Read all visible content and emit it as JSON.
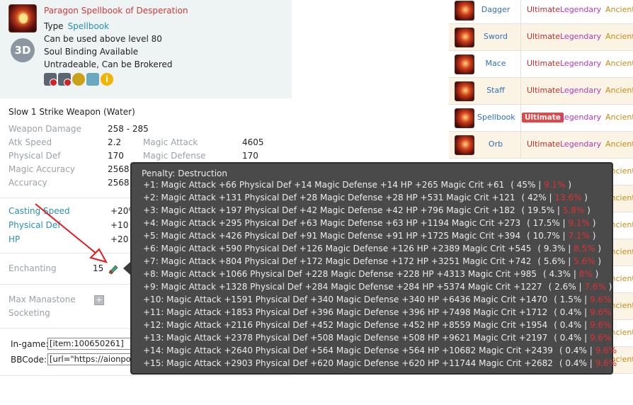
{
  "item": {
    "name": "Paragon Spellbook of Desperation",
    "type_label": "Type",
    "type_value": "Spellbook",
    "level_text": "Can be used above level 80",
    "soul_binding": "Soul Binding Available",
    "trade_text": "Untradeable, Can be Brokered",
    "badge_3d": "3D",
    "info_glyph": "i"
  },
  "subtitle": "Slow 1 Strike Weapon (Water)",
  "stats": [
    {
      "label": "Weapon Damage",
      "value": "258 - 285"
    },
    {
      "label": "Atk Speed",
      "value": "2.2",
      "label2": "Magic Attack",
      "value2": "4605"
    },
    {
      "label": "Physical Def",
      "value": "170",
      "label2": "Magic Defense",
      "value2": "170"
    },
    {
      "label": "Magic Accuracy",
      "value": "2568"
    },
    {
      "label": "Accuracy",
      "value": "2568"
    }
  ],
  "bonuses": [
    {
      "label": "Casting Speed",
      "value": "+20%"
    },
    {
      "label": "Physical Def",
      "value": "+10"
    },
    {
      "label": "HP",
      "value": "+20"
    }
  ],
  "enchanting": {
    "label": "Enchanting",
    "value": "15"
  },
  "manastone": {
    "label1": "Max Manastone",
    "label2": "Socketing",
    "glyph": "+"
  },
  "codes": {
    "ingame_label": "In-game:",
    "ingame_value": "[item:100650261]",
    "bbcode_label": "BBCode:",
    "bbcode_value": "[url=\"https://aionpow"
  },
  "weapons": [
    {
      "name": "Dagger",
      "ultimate": "Ultimate",
      "legendary": "Legendary",
      "ancient": "Ancient"
    },
    {
      "name": "Sword",
      "ultimate": "Ultimate",
      "legendary": "Legendary",
      "ancient": "Ancient"
    },
    {
      "name": "Mace",
      "ultimate": "Ultimate",
      "legendary": "Legendary",
      "ancient": "Ancient"
    },
    {
      "name": "Staff",
      "ultimate": "Ultimate",
      "legendary": "Legendary",
      "ancient": "Ancient"
    },
    {
      "name": "Spellbook",
      "ultimate": "Ultimate",
      "legendary": "Legendary",
      "ancient": "Ancient",
      "selected": true
    },
    {
      "name": "Orb",
      "ultimate": "Ultimate",
      "legendary": "Legendary",
      "ancient": "Ancient"
    }
  ],
  "hidden_ancient_labels": [
    "Ancient",
    "Ancient",
    "Ancient",
    "Ancient",
    "Ancient",
    "Ancient",
    "Ancient",
    "Ancient"
  ],
  "tooltip": {
    "title": "Penalty: Destruction",
    "lines": [
      {
        "text": "+1: Magic Attack +66 Physical Def +14 Magic Defense +14 HP +265 Magic Crit +61",
        "chance": "( 45% |",
        "penalty": "9.1%",
        "close": ")"
      },
      {
        "text": "+2: Magic Attack +131 Physical Def +28 Magic Defense +28 HP +531 Magic Crit +121",
        "chance": "( 42% |",
        "penalty": "13.6%",
        "close": ")"
      },
      {
        "text": "+3: Magic Attack +197 Physical Def +42 Magic Defense +42 HP +796 Magic Crit +182",
        "chance": "( 19.5% |",
        "penalty": "5.8%",
        "close": ")"
      },
      {
        "text": "+4: Magic Attack +295 Physical Def +63 Magic Defense +63 HP +1194 Magic Crit +273",
        "chance": "( 17.5% |",
        "penalty": "9.1%",
        "close": ")"
      },
      {
        "text": "+5: Magic Attack +426 Physical Def +91 Magic Defense +91 HP +1725 Magic Crit +394",
        "chance": "( 10.7% |",
        "penalty": "7.1%",
        "close": ")"
      },
      {
        "text": "+6: Magic Attack +590 Physical Def +126 Magic Defense +126 HP +2389 Magic Crit +545",
        "chance": "( 9.3% |",
        "penalty": "8.5%",
        "close": ")"
      },
      {
        "text": "+7: Magic Attack +804 Physical Def +172 Magic Defense +172 HP +3251 Magic Crit +742",
        "chance": "( 5.6% |",
        "penalty": "5.6%",
        "close": ")"
      },
      {
        "text": "+8: Magic Attack +1066 Physical Def +228 Magic Defense +228 HP +4313 Magic Crit +985",
        "chance": "( 4.3% |",
        "penalty": "8%",
        "close": ")"
      },
      {
        "text": "+9: Magic Attack +1328 Physical Def +284 Magic Defense +284 HP +5374 Magic Crit +1227",
        "chance": "( 2.6% |",
        "penalty": "7.6%",
        "close": ")"
      },
      {
        "text": "+10: Magic Attack +1591 Physical Def +340 Magic Defense +340 HP +6436 Magic Crit +1470",
        "chance": "( 1.5% |",
        "penalty": "9.6%",
        "close": ")"
      },
      {
        "text": "+11: Magic Attack +1853 Physical Def +396 Magic Defense +396 HP +7498 Magic Crit +1712",
        "chance": "( 0.4% |",
        "penalty": "9.6%",
        "close": ")"
      },
      {
        "text": "+12: Magic Attack +2116 Physical Def +452 Magic Defense +452 HP +8559 Magic Crit +1954",
        "chance": "( 0.4% |",
        "penalty": "9.6%",
        "close": ")"
      },
      {
        "text": "+13: Magic Attack +2378 Physical Def +508 Magic Defense +508 HP +9621 Magic Crit +2197",
        "chance": "( 0.4% |",
        "penalty": "9.6%",
        "close": ")"
      },
      {
        "text": "+14: Magic Attack +2640 Physical Def +564 Magic Defense +564 HP +10682 Magic Crit +2439",
        "chance": "( 0.4% |",
        "penalty": "9.6%",
        "close": ")"
      },
      {
        "text": "+15: Magic Attack +2903 Physical Def +620 Magic Defense +620 HP +11744 Magic Crit +2682",
        "chance": "( 0.4% |",
        "penalty": "9.6%",
        "close": ")"
      }
    ]
  },
  "colors": {
    "item_name": "#d03a3a",
    "link": "#2a8fb0",
    "ultimate": "#d02828",
    "legendary": "#b238b8",
    "ancient": "#c98a10",
    "tooltip_bg": "#4a4a4a",
    "penalty": "#e03030",
    "annotation_arrow": "#e81818"
  }
}
